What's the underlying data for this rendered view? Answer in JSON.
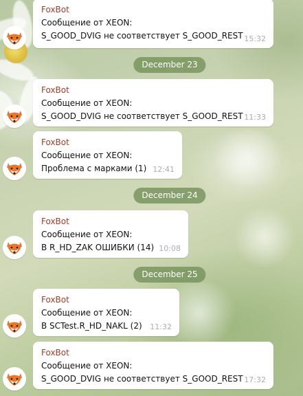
{
  "bot_name": "FoxBot",
  "messages": [
    {
      "sender": "FoxBot",
      "line1": "Сообщение от XEON:",
      "line2": "S_GOOD_DVIG не соответствует S_GOOD_REST",
      "time": "15:32"
    },
    {
      "sender": "FoxBot",
      "line1": "Сообщение от XEON:",
      "line2": "S_GOOD_DVIG не соответствует S_GOOD_REST",
      "time": "11:33"
    },
    {
      "sender": "FoxBot",
      "line1": "Сообщение от XEON:",
      "line2": "Проблема с марками (1)",
      "time": "12:41"
    },
    {
      "sender": "FoxBot",
      "line1": "Сообщение от XEON:",
      "line2": "В R_HD_ZAK ОШИБКИ (14)",
      "time": "10:08"
    },
    {
      "sender": "FoxBot",
      "line1": "Сообщение от XEON:",
      "line2": "В SCTest.R_HD_NAKL  (2)",
      "time": "11:32"
    },
    {
      "sender": "FoxBot",
      "line1": "Сообщение от XEON:",
      "line2": "S_GOOD_DVIG не соответствует S_GOOD_REST",
      "time": "17:32"
    }
  ],
  "date_separators": [
    {
      "label": "December 23"
    },
    {
      "label": "December 24"
    },
    {
      "label": "December 25"
    }
  ],
  "colors": {
    "sender_name": "#a33c29",
    "date_pill": "#76925c",
    "timestamp": "#a7aeb4",
    "fox_orange": "#e8772e"
  },
  "icons": {
    "avatar": "fox-icon"
  }
}
